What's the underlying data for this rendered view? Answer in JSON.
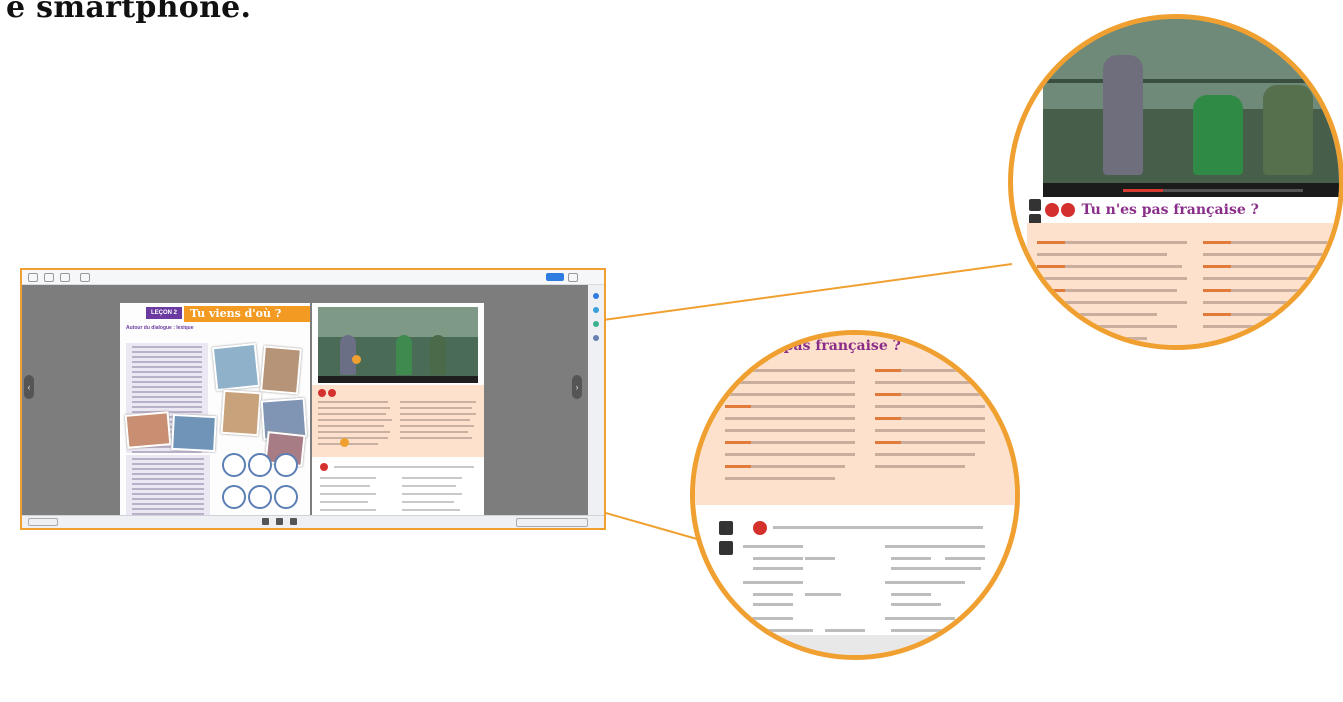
{
  "heading": "e smartphone.",
  "book": {
    "lecon_label": "LEÇON 2",
    "lesson_title": "Tu viens d'où ?",
    "section_label": "Autour du dialogue : lexique"
  },
  "callout_top": {
    "dialogue_title": "Tu n'es pas française ?"
  },
  "callout_bottom": {
    "dialogue_title": "s pas française ?"
  },
  "colors": {
    "accent_orange": "#f0a030",
    "lesson_purple": "#6a3aa0",
    "dialogue_peach": "#fde1cc",
    "audio_red": "#d4302d"
  },
  "icons": [
    "chevron-left-icon",
    "chevron-right-icon",
    "pen-icon",
    "check-icon",
    "video-play-icon"
  ]
}
